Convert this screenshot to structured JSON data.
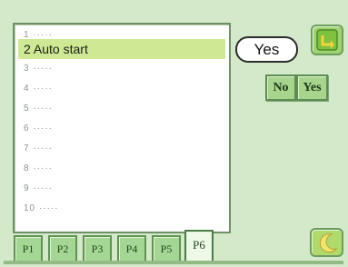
{
  "list": {
    "items": [
      {
        "number": "1",
        "label": "·····"
      },
      {
        "number": "2",
        "label": "Auto start"
      },
      {
        "number": "3",
        "label": "·····"
      },
      {
        "number": "4",
        "label": "·····"
      },
      {
        "number": "5",
        "label": "·····"
      },
      {
        "number": "6",
        "label": "·····"
      },
      {
        "number": "7",
        "label": "·····"
      },
      {
        "number": "8",
        "label": "·····"
      },
      {
        "number": "9",
        "label": "·····"
      },
      {
        "number": "10",
        "label": "·····"
      }
    ],
    "selected_index": 1
  },
  "setting": {
    "current_value": "Yes",
    "no_label": "No",
    "yes_label": "Yes"
  },
  "tabs": {
    "labels": [
      "P1",
      "P2",
      "P3",
      "P4",
      "P5",
      "P6"
    ],
    "active_index": 5
  },
  "colors": {
    "background": "#d3e9c9",
    "selected_row": "#cfe893",
    "button": "#a7d58d"
  },
  "icons": {
    "top_right": "return-arrow-icon",
    "bottom_right": "moon-icon"
  }
}
